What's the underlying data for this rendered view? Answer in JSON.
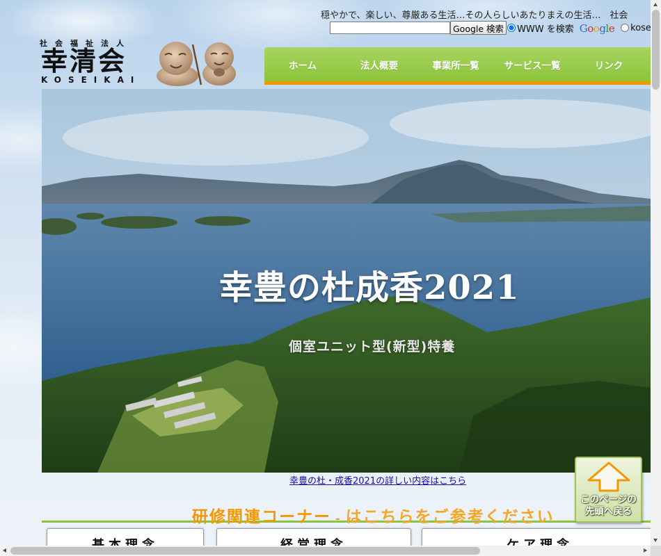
{
  "header": {
    "tagline": "穏やかで、楽しい、尊厳ある生活…その人らしいあたりまえの生活…　社会",
    "search": {
      "input_value": "",
      "button_label": "Google 検索",
      "radio_www_label": "WWW を検索",
      "radio_site_label": "koseik",
      "google_logo": "Google"
    }
  },
  "logo": {
    "sub": "社会福祉法人",
    "main": "幸清会",
    "en": "KOSEIKAI"
  },
  "nav": {
    "items": [
      {
        "label": "ホーム"
      },
      {
        "label": "法人概要"
      },
      {
        "label": "事業所一覧"
      },
      {
        "label": "サービス一覧"
      },
      {
        "label": "リンク"
      }
    ]
  },
  "hero": {
    "title": "幸豊の杜成香2021",
    "subtitle": "個室ユニット型(新型)特養",
    "link": "幸豊の杜・成香2021の詳しい内容はこちら"
  },
  "training": {
    "lead": "研修関連コーナー",
    "separator": "-",
    "rest": "はこちらをご参考ください"
  },
  "pagetop": {
    "line1": "このページの",
    "line2": "先頭へ戻る"
  },
  "cards": [
    {
      "title": "基本理念"
    },
    {
      "title": "経営理念"
    },
    {
      "title": "ケア理念"
    }
  ],
  "colors": {
    "nav_green": "#8cc43c",
    "nav_orange": "#f39800",
    "training_orange": "#f39800",
    "link_blue": "#1a0dab"
  },
  "icons": {
    "pagetop": "arrow-up-icon",
    "logo_figures": "jizo-figures-icon"
  }
}
